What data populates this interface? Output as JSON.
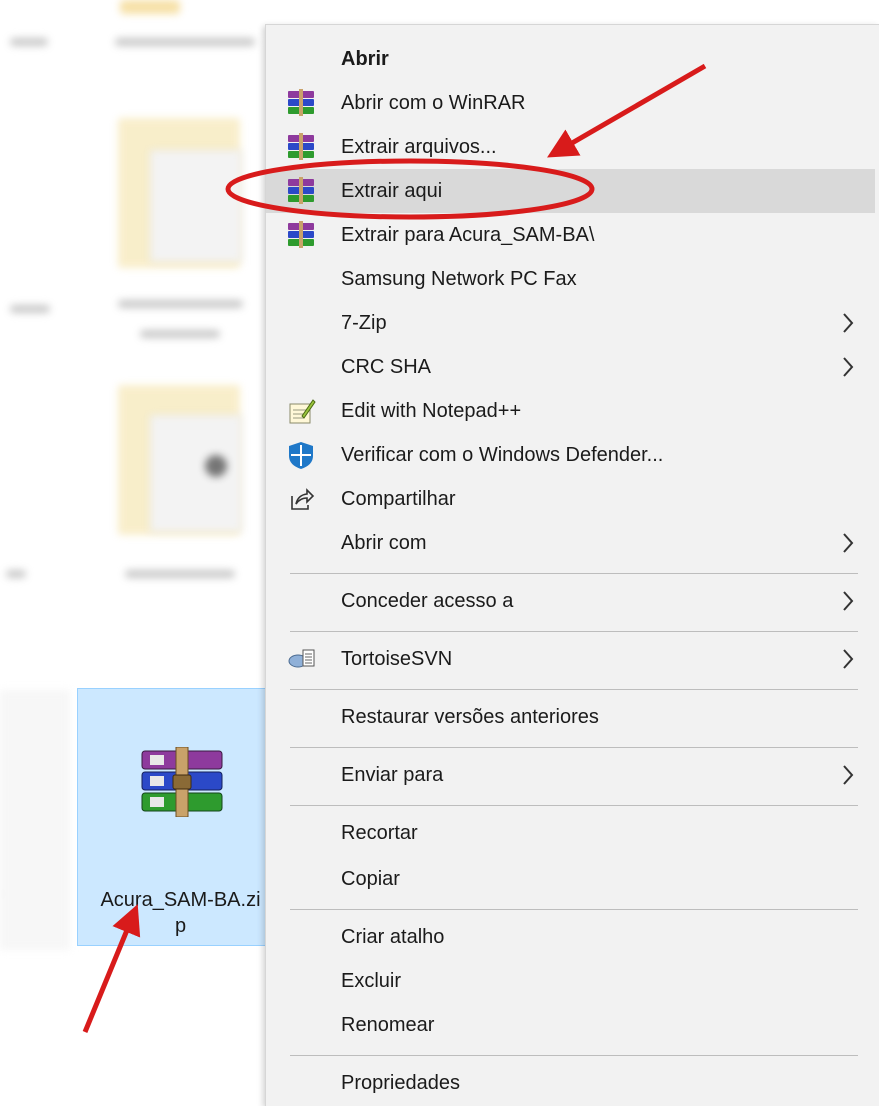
{
  "file": {
    "name_line1": "Acura_SAM-BA.zi",
    "name_line2": "p",
    "icon": "winrar-archive-icon"
  },
  "menu": {
    "items": [
      {
        "label": "Abrir",
        "icon": ""
      },
      {
        "label": "Abrir com o WinRAR",
        "icon": "winrar-icon"
      },
      {
        "label": "Extrair arquivos...",
        "icon": "winrar-icon"
      },
      {
        "label": "Extrair aqui",
        "icon": "winrar-icon"
      },
      {
        "label": "Extrair para Acura_SAM-BA\\",
        "icon": "winrar-icon"
      },
      {
        "label": "Samsung Network PC Fax",
        "icon": ""
      },
      {
        "label": "7-Zip",
        "icon": "",
        "submenu": true
      },
      {
        "label": "CRC SHA",
        "icon": "",
        "submenu": true
      },
      {
        "label": "Edit with Notepad++",
        "icon": "notepad-plus-plus-icon"
      },
      {
        "label": "Verificar com o Windows Defender...",
        "icon": "windows-defender-icon"
      },
      {
        "label": "Compartilhar",
        "icon": "share-icon"
      },
      {
        "label": "Abrir com",
        "icon": "",
        "submenu": true
      },
      {
        "label": "Conceder acesso a",
        "icon": "",
        "submenu": true
      },
      {
        "label": "TortoiseSVN",
        "icon": "tortoisesvn-icon",
        "submenu": true
      },
      {
        "label": "Restaurar versões anteriores",
        "icon": ""
      },
      {
        "label": "Enviar para",
        "icon": "",
        "submenu": true
      },
      {
        "label": "Recortar",
        "icon": ""
      },
      {
        "label": "Copiar",
        "icon": ""
      },
      {
        "label": "Criar atalho",
        "icon": ""
      },
      {
        "label": "Excluir",
        "icon": ""
      },
      {
        "label": "Renomear",
        "icon": ""
      },
      {
        "label": "Propriedades",
        "icon": ""
      }
    ],
    "highlighted": "Extrair aqui"
  },
  "colors": {
    "menu_bg": "#f2f2f2",
    "hover_bg": "#d9d9d9",
    "selection_bg": "#cce8ff",
    "annotation_red": "#d81b1b"
  }
}
